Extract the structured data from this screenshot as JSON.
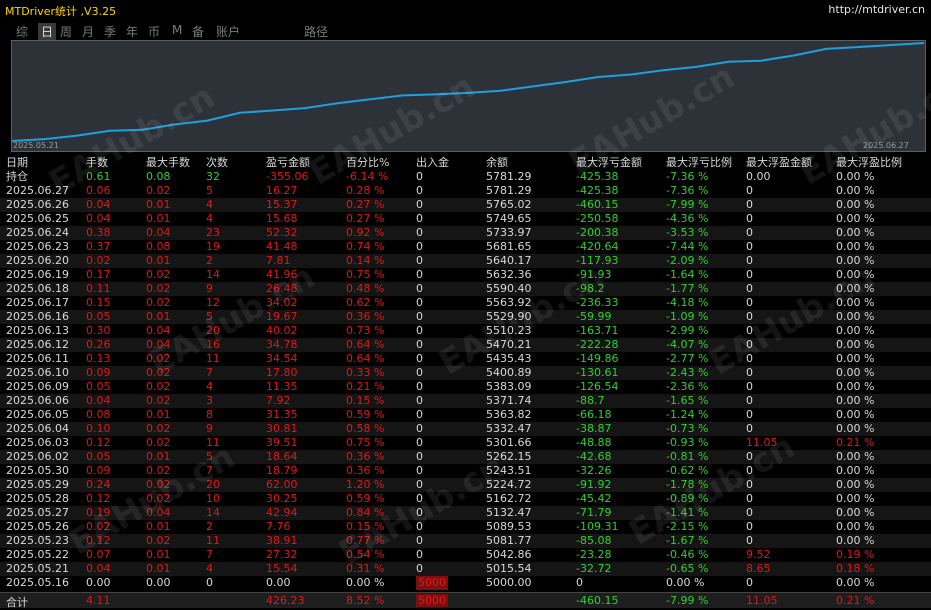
{
  "header": {
    "title": "MTDriver统计 ,V3.25",
    "url": "http://mtdriver.cn"
  },
  "tabs": [
    {
      "label": "综",
      "active": false
    },
    {
      "label": "日",
      "active": true
    },
    {
      "label": "周",
      "active": false
    },
    {
      "label": "月",
      "active": false
    },
    {
      "label": "季",
      "active": false
    },
    {
      "label": "年",
      "active": false
    },
    {
      "label": "币",
      "active": false
    },
    {
      "label": "M",
      "active": false
    },
    {
      "label": "备",
      "active": false
    },
    {
      "label": "账户",
      "active": false
    },
    {
      "label": "路径",
      "active": false
    }
  ],
  "chart_data": {
    "type": "line",
    "x_start": "2025.05.21",
    "x_end": "2025.06.27",
    "color": "#1e9fe0",
    "x": [
      "2025.05.16",
      "2025.05.21",
      "2025.05.22",
      "2025.05.23",
      "2025.05.26",
      "2025.05.27",
      "2025.05.28",
      "2025.05.29",
      "2025.05.30",
      "2025.06.02",
      "2025.06.03",
      "2025.06.04",
      "2025.06.05",
      "2025.06.06",
      "2025.06.09",
      "2025.06.10",
      "2025.06.11",
      "2025.06.12",
      "2025.06.13",
      "2025.06.16",
      "2025.06.17",
      "2025.06.18",
      "2025.06.19",
      "2025.06.20",
      "2025.06.23",
      "2025.06.24",
      "2025.06.25",
      "2025.06.26",
      "2025.06.27"
    ],
    "values": [
      5000.0,
      5015.54,
      5042.86,
      5081.77,
      5089.53,
      5132.47,
      5162.72,
      5224.72,
      5243.51,
      5262.15,
      5301.66,
      5332.47,
      5363.82,
      5371.74,
      5383.09,
      5400.89,
      5435.43,
      5470.21,
      5510.23,
      5529.9,
      5563.92,
      5590.4,
      5632.36,
      5640.17,
      5681.65,
      5733.97,
      5749.65,
      5765.02,
      5781.29
    ]
  },
  "table": {
    "columns": [
      "日期",
      "手数",
      "最大手数",
      "次数",
      "盈亏金额",
      "百分比%",
      "出入金",
      "余额",
      "最大浮亏金额",
      "最大浮亏比例",
      "最大浮盈金额",
      "最大浮盈比例"
    ],
    "holding": [
      "持仓",
      "0.61",
      "0.08",
      "32",
      "-355.06",
      "-6.14 %",
      "0",
      "5781.29",
      "-425.38",
      "-7.36 %",
      "0.00",
      "0.00 %"
    ],
    "rows": [
      [
        "2025.06.27",
        "0.06",
        "0.02",
        "5",
        "16.27",
        "0.28 %",
        "0",
        "5781.29",
        "-425.38",
        "-7.36 %",
        "0",
        "0.00 %"
      ],
      [
        "2025.06.26",
        "0.04",
        "0.01",
        "4",
        "15.37",
        "0.27 %",
        "0",
        "5765.02",
        "-460.15",
        "-7.99 %",
        "0",
        "0.00 %"
      ],
      [
        "2025.06.25",
        "0.04",
        "0.01",
        "4",
        "15.68",
        "0.27 %",
        "0",
        "5749.65",
        "-250.58",
        "-4.36 %",
        "0",
        "0.00 %"
      ],
      [
        "2025.06.24",
        "0.38",
        "0.04",
        "23",
        "52.32",
        "0.92 %",
        "0",
        "5733.97",
        "-200.38",
        "-3.53 %",
        "0",
        "0.00 %"
      ],
      [
        "2025.06.23",
        "0.37",
        "0.08",
        "19",
        "41.48",
        "0.74 %",
        "0",
        "5681.65",
        "-420.64",
        "-7.44 %",
        "0",
        "0.00 %"
      ],
      [
        "2025.06.20",
        "0.02",
        "0.01",
        "2",
        "7.81",
        "0.14 %",
        "0",
        "5640.17",
        "-117.93",
        "-2.09 %",
        "0",
        "0.00 %"
      ],
      [
        "2025.06.19",
        "0.17",
        "0.02",
        "14",
        "41.96",
        "0.75 %",
        "0",
        "5632.36",
        "-91.93",
        "-1.64 %",
        "0",
        "0.00 %"
      ],
      [
        "2025.06.18",
        "0.11",
        "0.02",
        "9",
        "26.48",
        "0.48 %",
        "0",
        "5590.40",
        "-98.2",
        "-1.77 %",
        "0",
        "0.00 %"
      ],
      [
        "2025.06.17",
        "0.15",
        "0.02",
        "12",
        "34.02",
        "0.62 %",
        "0",
        "5563.92",
        "-236.33",
        "-4.18 %",
        "0",
        "0.00 %"
      ],
      [
        "2025.06.16",
        "0.05",
        "0.01",
        "5",
        "19.67",
        "0.36 %",
        "0",
        "5529.90",
        "-59.99",
        "-1.09 %",
        "0",
        "0.00 %"
      ],
      [
        "2025.06.13",
        "0.30",
        "0.04",
        "20",
        "40.02",
        "0.73 %",
        "0",
        "5510.23",
        "-163.71",
        "-2.99 %",
        "0",
        "0.00 %"
      ],
      [
        "2025.06.12",
        "0.26",
        "0.04",
        "16",
        "34.78",
        "0.64 %",
        "0",
        "5470.21",
        "-222.28",
        "-4.07 %",
        "0",
        "0.00 %"
      ],
      [
        "2025.06.11",
        "0.13",
        "0.02",
        "11",
        "34.54",
        "0.64 %",
        "0",
        "5435.43",
        "-149.86",
        "-2.77 %",
        "0",
        "0.00 %"
      ],
      [
        "2025.06.10",
        "0.09",
        "0.02",
        "7",
        "17.80",
        "0.33 %",
        "0",
        "5400.89",
        "-130.61",
        "-2.43 %",
        "0",
        "0.00 %"
      ],
      [
        "2025.06.09",
        "0.05",
        "0.02",
        "4",
        "11.35",
        "0.21 %",
        "0",
        "5383.09",
        "-126.54",
        "-2.36 %",
        "0",
        "0.00 %"
      ],
      [
        "2025.06.06",
        "0.04",
        "0.02",
        "3",
        "7.92",
        "0.15 %",
        "0",
        "5371.74",
        "-88.7",
        "-1.65 %",
        "0",
        "0.00 %"
      ],
      [
        "2025.06.05",
        "0.08",
        "0.01",
        "8",
        "31.35",
        "0.59 %",
        "0",
        "5363.82",
        "-66.18",
        "-1.24 %",
        "0",
        "0.00 %"
      ],
      [
        "2025.06.04",
        "0.10",
        "0.02",
        "9",
        "30.81",
        "0.58 %",
        "0",
        "5332.47",
        "-38.87",
        "-0.73 %",
        "0",
        "0.00 %"
      ],
      [
        "2025.06.03",
        "0.12",
        "0.02",
        "11",
        "39.51",
        "0.75 %",
        "0",
        "5301.66",
        "-48.88",
        "-0.93 %",
        "11.05",
        "0.21 %"
      ],
      [
        "2025.06.02",
        "0.05",
        "0.01",
        "5",
        "18.64",
        "0.36 %",
        "0",
        "5262.15",
        "-42.68",
        "-0.81 %",
        "0",
        "0.00 %"
      ],
      [
        "2025.05.30",
        "0.09",
        "0.02",
        "7",
        "18.79",
        "0.36 %",
        "0",
        "5243.51",
        "-32.26",
        "-0.62 %",
        "0",
        "0.00 %"
      ],
      [
        "2025.05.29",
        "0.24",
        "0.02",
        "20",
        "62.00",
        "1.20 %",
        "0",
        "5224.72",
        "-91.92",
        "-1.78 %",
        "0",
        "0.00 %"
      ],
      [
        "2025.05.28",
        "0.12",
        "0.02",
        "10",
        "30.25",
        "0.59 %",
        "0",
        "5162.72",
        "-45.42",
        "-0.89 %",
        "0",
        "0.00 %"
      ],
      [
        "2025.05.27",
        "0.19",
        "0.04",
        "14",
        "42.94",
        "0.84 %",
        "0",
        "5132.47",
        "-71.79",
        "-1.41 %",
        "0",
        "0.00 %"
      ],
      [
        "2025.05.26",
        "0.02",
        "0.01",
        "2",
        "7.76",
        "0.15 %",
        "0",
        "5089.53",
        "-109.31",
        "-2.15 %",
        "0",
        "0.00 %"
      ],
      [
        "2025.05.23",
        "0.12",
        "0.02",
        "11",
        "38.91",
        "0.77 %",
        "0",
        "5081.77",
        "-85.08",
        "-1.67 %",
        "0",
        "0.00 %"
      ],
      [
        "2025.05.22",
        "0.07",
        "0.01",
        "7",
        "27.32",
        "0.54 %",
        "0",
        "5042.86",
        "-23.28",
        "-0.46 %",
        "9.52",
        "0.19 %"
      ],
      [
        "2025.05.21",
        "0.04",
        "0.01",
        "4",
        "15.54",
        "0.31 %",
        "0",
        "5015.54",
        "-32.72",
        "-0.65 %",
        "8.65",
        "0.18 %"
      ],
      [
        "2025.05.16",
        "0.00",
        "0.00",
        "0",
        "0.00",
        "0.00 %",
        "5000",
        "5000.00",
        "0",
        "0.00 %",
        "0",
        "0.00 %"
      ]
    ],
    "total": [
      "合计",
      "4.11",
      "",
      "",
      "426.23",
      "8.52 %",
      "5000",
      "",
      "-460.15",
      "-7.99 %",
      "11.05",
      "0.21 %"
    ]
  },
  "watermark": "EAHub.cn"
}
